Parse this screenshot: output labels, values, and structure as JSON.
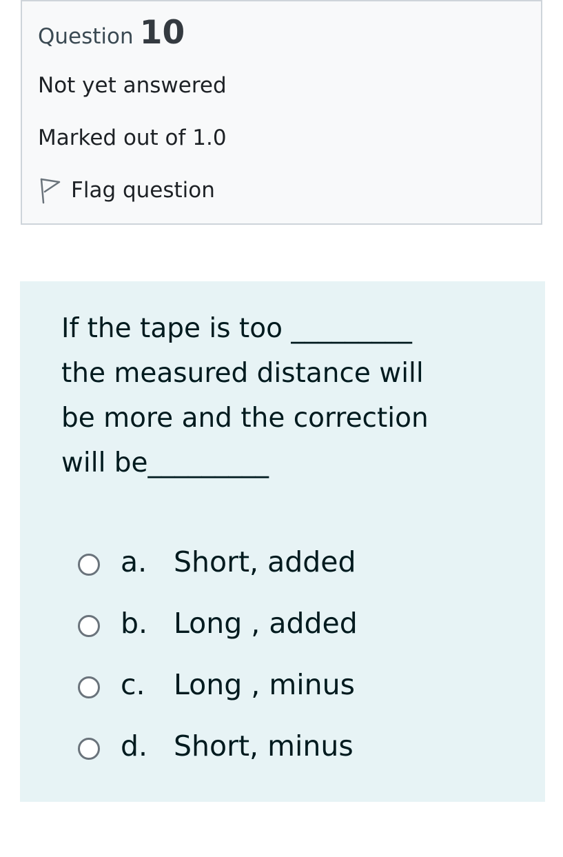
{
  "info": {
    "question_word": "Question",
    "question_number": "10",
    "state": "Not yet answered",
    "grade": "Marked out of 1.0",
    "flag_label": "Flag question"
  },
  "question": {
    "lines": [
      "If the tape is too _________",
      "the measured distance will",
      "be more and the correction",
      "will be_________"
    ]
  },
  "answers": [
    {
      "letter": "a.",
      "text": "Short, added"
    },
    {
      "letter": "b.",
      "text": "Long , added"
    },
    {
      "letter": "c.",
      "text": "Long , minus"
    },
    {
      "letter": "d.",
      "text": "Short, minus"
    }
  ],
  "colors": {
    "info_background": "#f8f9fa",
    "info_border": "#ced4da",
    "question_background": "#e7f3f5",
    "text": "#001a1e"
  },
  "icons": {
    "flag": "flag-outline-icon",
    "radio": "radio-unchecked-icon"
  }
}
